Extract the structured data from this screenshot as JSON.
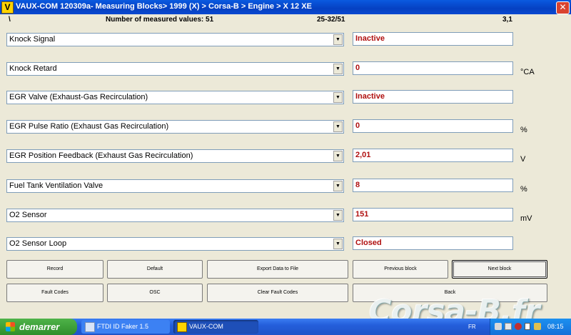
{
  "window": {
    "title": "VAUX-COM 120309a- Measuring Blocks> 1999 (X) > Corsa-B > Engine > X 12 XE",
    "icon_letter": "V",
    "close_glyph": "✕"
  },
  "info": {
    "backslash": "\\",
    "measured": "Number of measured values: 51",
    "range": "25-32/51",
    "block": "3,1"
  },
  "rows": [
    {
      "label": "Knock Signal",
      "value": "Inactive",
      "unit": ""
    },
    {
      "label": "Knock Retard",
      "value": "0",
      "unit": "°CA"
    },
    {
      "label": "EGR Valve (Exhaust-Gas Recirculation)",
      "value": "Inactive",
      "unit": ""
    },
    {
      "label": "EGR Pulse Ratio (Exhaust Gas Recirculation)",
      "value": "0",
      "unit": "%"
    },
    {
      "label": "EGR Position Feedback (Exhaust Gas Recirculation)",
      "value": "2,01",
      "unit": "V"
    },
    {
      "label": "Fuel Tank Ventilation Valve",
      "value": "8",
      "unit": "%"
    },
    {
      "label": "O2 Sensor",
      "value": "151",
      "unit": "mV"
    },
    {
      "label": "O2 Sensor Loop",
      "value": "Closed",
      "unit": ""
    }
  ],
  "dropdown_arrow": "▼",
  "buttons": {
    "record": "Record",
    "default": "Default",
    "export": "Export Data to File",
    "previous": "Previous block",
    "next": "Next block",
    "fault_codes": "Fault Codes",
    "osc": "OSC",
    "clear_fault": "Clear Fault Codes",
    "back": "Back"
  },
  "taskbar": {
    "start": "demarrer",
    "tasks": [
      "FTDI ID Faker 1.5",
      "VAUX-COM"
    ],
    "lang": "FR",
    "clock": "08:15"
  },
  "watermark": "Corsa-B.fr",
  "colors": {
    "value_text": "#b01010",
    "title_bar": "#0a5ae0",
    "taskbar": "#245edb",
    "start": "#3a9c35"
  }
}
